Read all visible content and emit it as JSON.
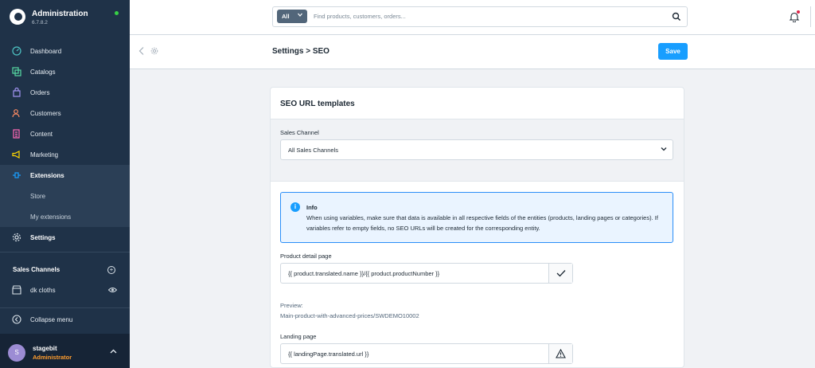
{
  "brand": {
    "title": "Administration",
    "version": "6.7.8.2"
  },
  "nav": {
    "items": [
      {
        "label": "Dashboard",
        "icon": "dashboard-icon"
      },
      {
        "label": "Catalogs",
        "icon": "catalogs-icon"
      },
      {
        "label": "Orders",
        "icon": "orders-icon"
      },
      {
        "label": "Customers",
        "icon": "customers-icon"
      },
      {
        "label": "Content",
        "icon": "content-icon"
      },
      {
        "label": "Marketing",
        "icon": "marketing-icon"
      },
      {
        "label": "Extensions",
        "icon": "extensions-icon"
      },
      {
        "label": "Store",
        "icon": ""
      },
      {
        "label": "My extensions",
        "icon": ""
      },
      {
        "label": "Settings",
        "icon": "settings-icon"
      }
    ]
  },
  "sales_channels": {
    "heading": "Sales Channels",
    "items": [
      {
        "label": "dk cloths"
      }
    ]
  },
  "collapse_label": "Collapse menu",
  "user": {
    "initial": "S",
    "name": "stagebit",
    "role": "Administrator"
  },
  "search": {
    "type_label": "All",
    "placeholder": "Find products, customers, orders..."
  },
  "smartbar": {
    "title": "Settings > SEO",
    "save_label": "Save"
  },
  "seo": {
    "card_title": "SEO URL templates",
    "channel_label": "Sales Channel",
    "channel_value": "All Sales Channels",
    "info_title": "Info",
    "info_text": "When using variables, make sure that data is available in all respective fields of the entities (products, landing pages or categories). If variables refer to empty fields, no SEO URLs will be created for the corresponding entity.",
    "product_label": "Product detail page",
    "product_value": "{{ product.translated.name }}/{{ product.productNumber }}",
    "preview_label": "Preview:",
    "preview_value": "Main-product-with-advanced-prices/SWDEMO10002",
    "landing_label": "Landing page",
    "landing_value": "{{ landingPage.translated.url }}"
  },
  "colors": {
    "sidebar": "#1f3248",
    "accent": "#189eff",
    "role": "#ff9d2e",
    "online": "#37d046"
  }
}
